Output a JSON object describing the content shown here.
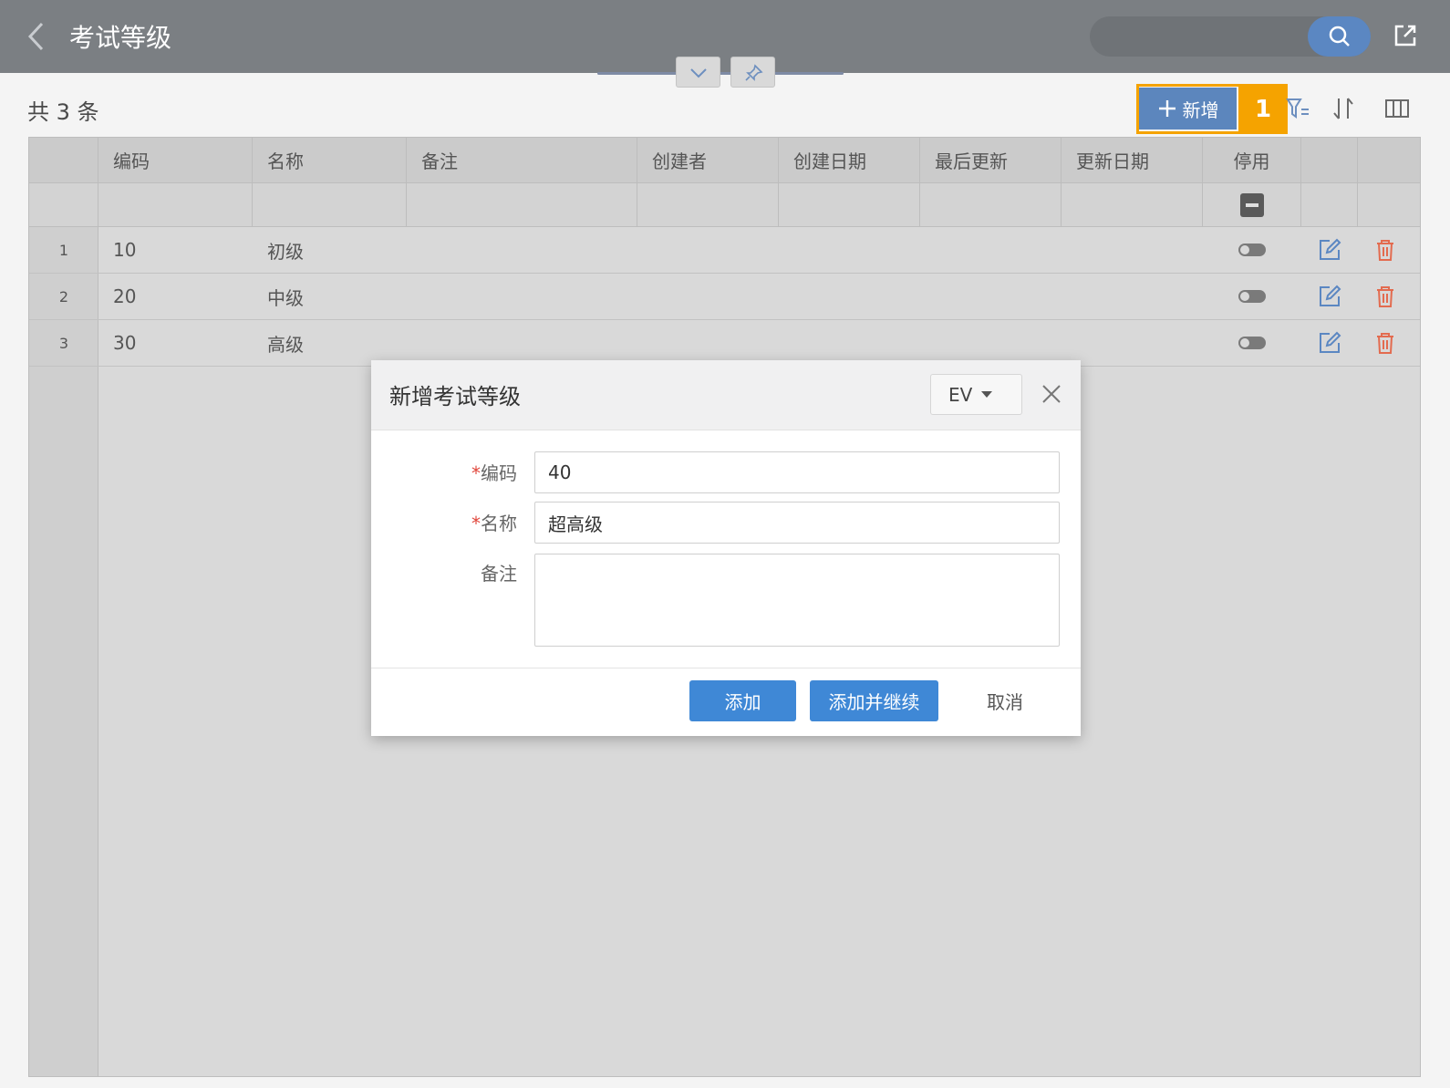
{
  "header": {
    "title": "考试等级",
    "search_placeholder": ""
  },
  "toolbar": {
    "total_text": "共 3 条",
    "add_label": "新增",
    "step_badge": "1"
  },
  "table": {
    "columns": [
      "编码",
      "名称",
      "备注",
      "创建者",
      "创建日期",
      "最后更新",
      "更新日期",
      "停用"
    ],
    "rows": [
      {
        "num": "1",
        "code": "10",
        "name": "初级"
      },
      {
        "num": "2",
        "code": "20",
        "name": "中级"
      },
      {
        "num": "3",
        "code": "30",
        "name": "高级"
      }
    ]
  },
  "dialog": {
    "title": "新增考试等级",
    "lang": "EV",
    "required_mark": "*",
    "fields": {
      "code_label": "编码",
      "code_value": "40",
      "name_label": "名称",
      "name_value": "超高级",
      "note_label": "备注",
      "note_value": ""
    },
    "buttons": {
      "add": "添加",
      "add_continue": "添加并继续",
      "cancel": "取消"
    }
  },
  "colors": {
    "accent": "#3f88d6",
    "highlight": "#f5a300",
    "delete": "#e36b4f",
    "edit": "#5b87c2"
  }
}
